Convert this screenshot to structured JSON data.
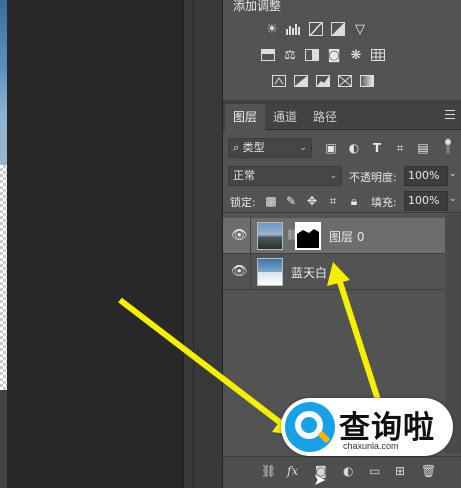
{
  "adjustments": {
    "title": "添加调整",
    "row1": [
      "sun-brightness-icon",
      "levels-icon",
      "curves-icon",
      "exposure-icon",
      "triangle-icon"
    ],
    "row2": [
      "grid-icon",
      "balance-icon",
      "bw-icon",
      "camera-icon",
      "circles-icon",
      "table-icon"
    ],
    "row3": [
      "invert-icon",
      "posterize-icon",
      "threshold-icon",
      "selective-icon",
      "gradient-icon"
    ]
  },
  "tabs": [
    {
      "label": "图层",
      "active": true
    },
    {
      "label": "通道",
      "active": false
    },
    {
      "label": "路径",
      "active": false
    }
  ],
  "filter": {
    "kind_label": "类型",
    "search_glyph": "⌕"
  },
  "blend": {
    "mode": "正常",
    "opacity_label": "不透明度:",
    "opacity_value": "100%"
  },
  "lock": {
    "label": "锁定:",
    "fill_label": "填充:",
    "fill_value": "100%"
  },
  "layers": [
    {
      "name": "图层 0",
      "selected": true,
      "has_mask": true
    },
    {
      "name": "蓝天白",
      "selected": false,
      "has_mask": false
    }
  ],
  "footer": {
    "icons": [
      "link-icon",
      "fx-icon",
      "mask-icon",
      "adjustment-icon",
      "group-icon",
      "new-layer-icon",
      "delete-icon"
    ]
  },
  "watermark": {
    "text": "查询啦",
    "sub": "chaxunla.com"
  },
  "colors": {
    "arrow": "#f5f000",
    "panel": "#535353",
    "selected_layer": "#6d6d6d"
  }
}
